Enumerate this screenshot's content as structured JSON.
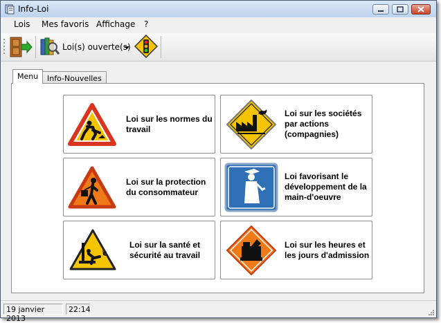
{
  "window": {
    "title": "Info-Loi"
  },
  "menubar": {
    "items": [
      "Lois",
      "Mes favoris",
      "Affichage",
      "?"
    ]
  },
  "toolbar": {
    "open_laws_label": "Loi(s) ouverte(s)"
  },
  "tabs": [
    {
      "label": "Menu",
      "active": true
    },
    {
      "label": "Info-Nouvelles",
      "active": false
    }
  ],
  "laws": [
    {
      "label": "Loi sur les normes du travail",
      "icon": "worker-warning-icon"
    },
    {
      "label": "Loi sur les sociétés par actions (compagnies)",
      "icon": "factory-icon"
    },
    {
      "label": "Loi sur la protection du consommateur",
      "icon": "shopper-warning-icon"
    },
    {
      "label": "Loi favorisant le développement de la main-d'oeuvre",
      "icon": "graduate-icon"
    },
    {
      "label": "Loi sur la santé et sécurité au travail",
      "icon": "falling-worker-icon"
    },
    {
      "label": "Loi sur les heures et les jours d'admission",
      "icon": "cash-register-icon"
    }
  ],
  "status": {
    "date": "19 janvier 2013",
    "time": "22:14"
  },
  "colors": {
    "warning_red": "#d8341e",
    "warning_orange": "#f07a1a",
    "sign_yellow": "#f5c400",
    "sign_blue": "#2f6fb5"
  }
}
